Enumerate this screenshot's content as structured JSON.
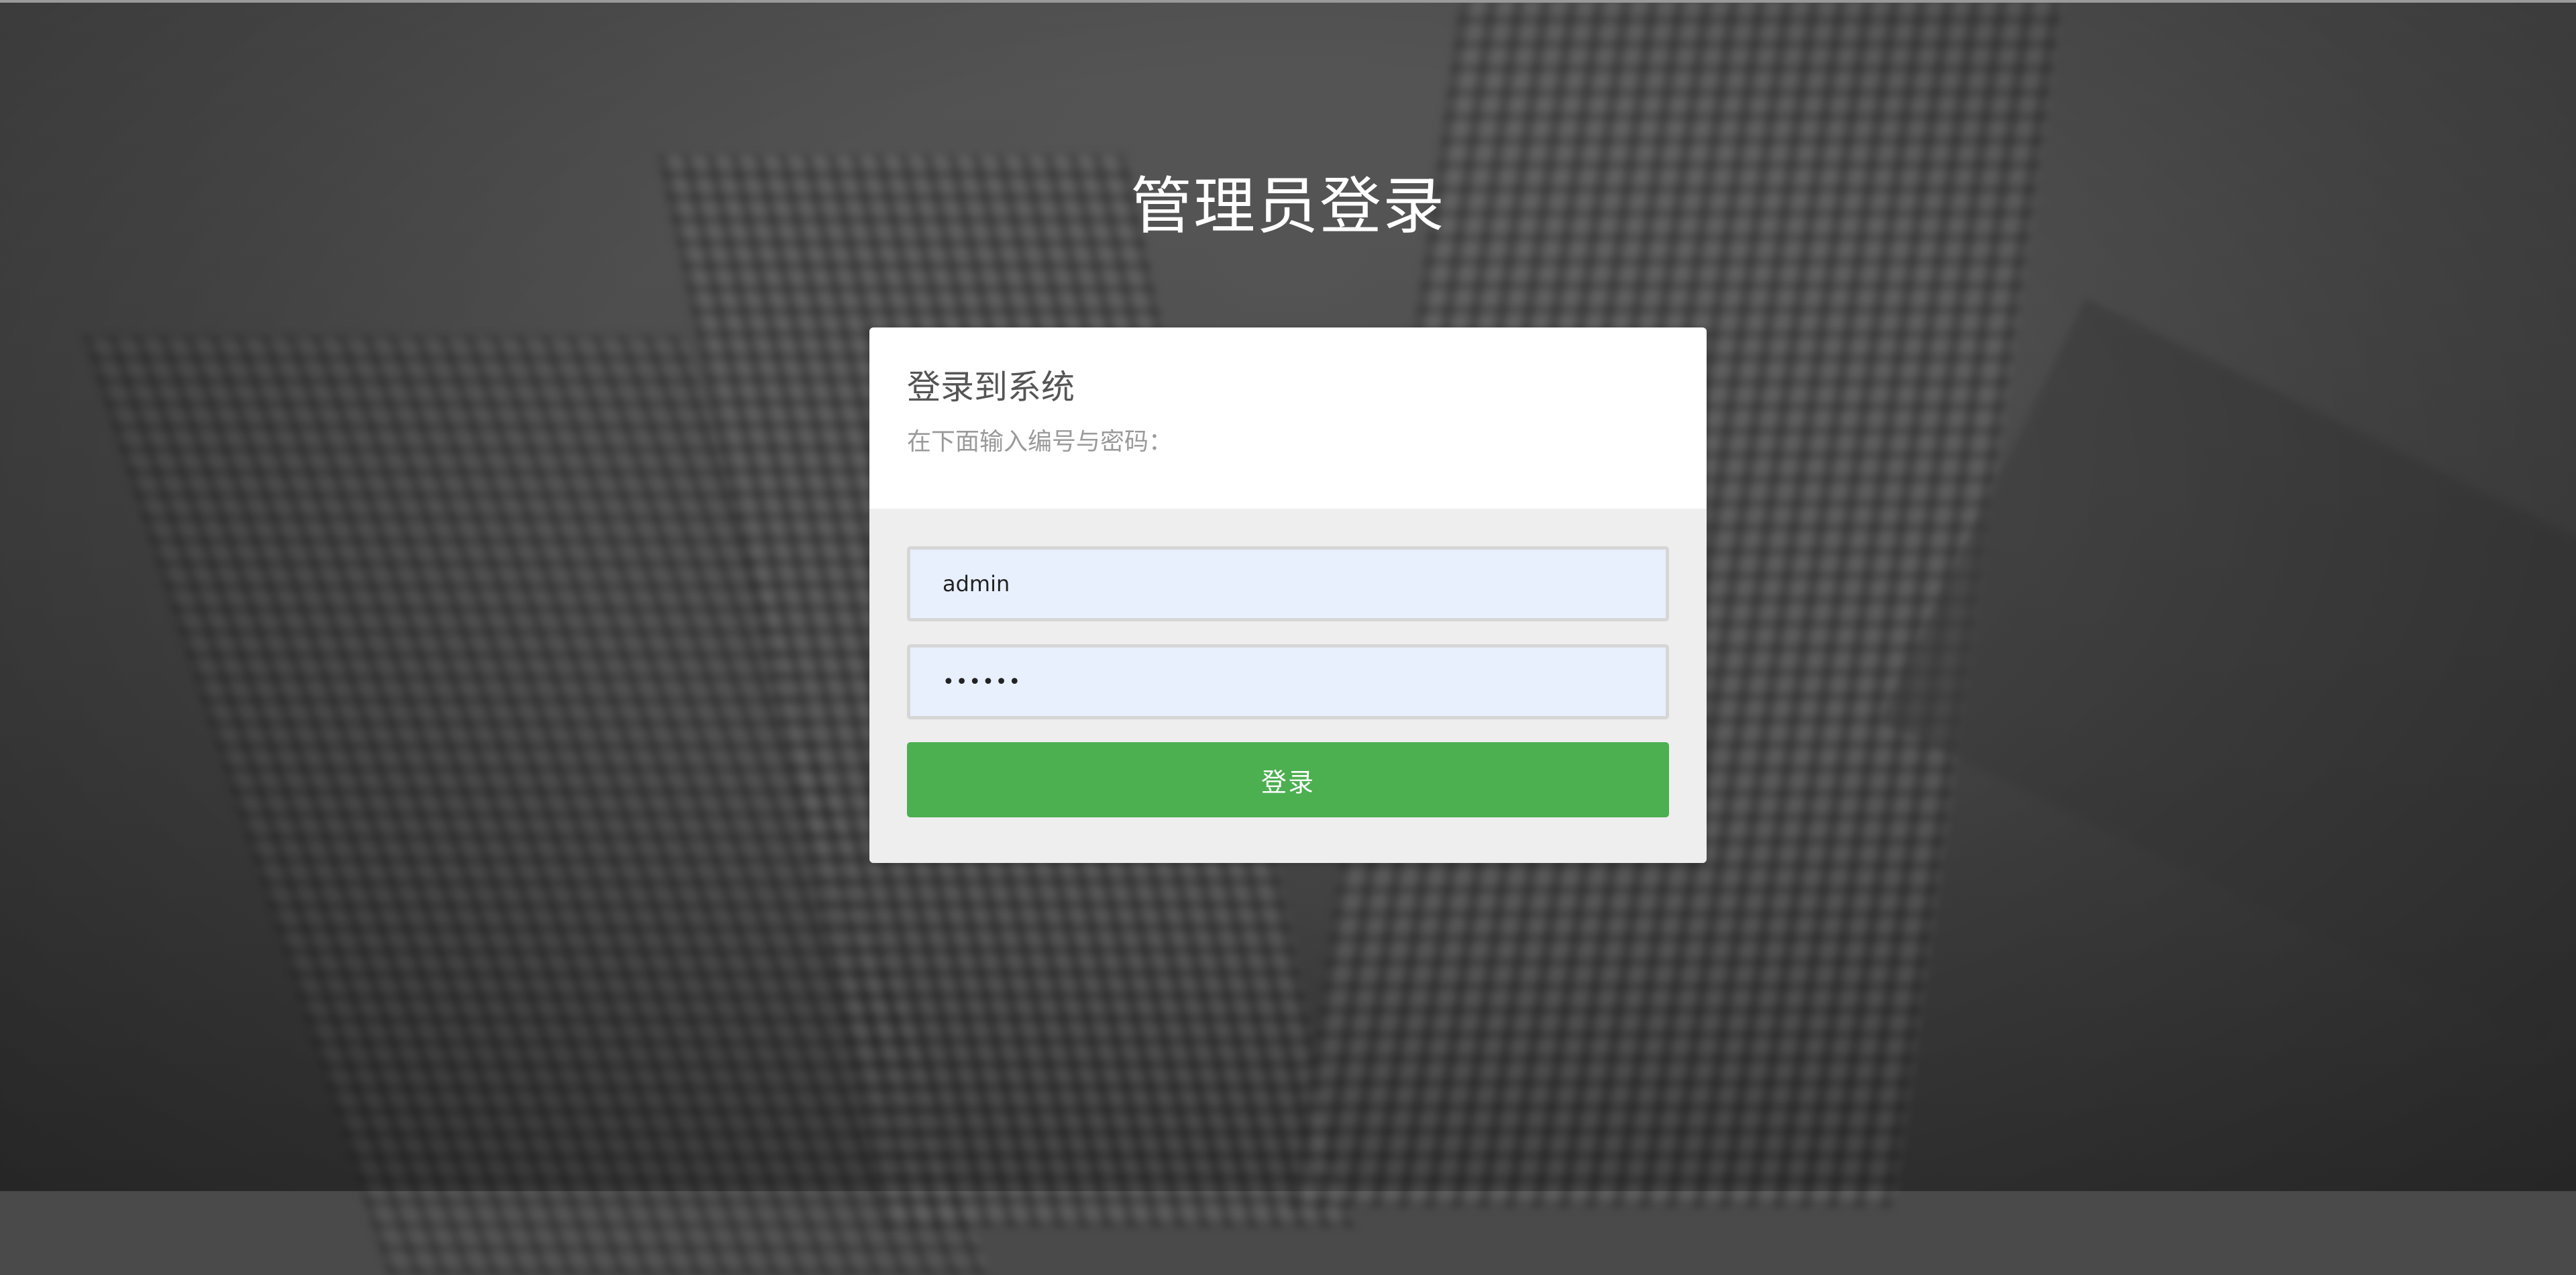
{
  "page": {
    "title": "管理员登录"
  },
  "card": {
    "heading": "登录到系统",
    "subtitle": "在下面输入编号与密码："
  },
  "form": {
    "username_value": "admin",
    "password_value": "123456",
    "login_button": "登录"
  },
  "colors": {
    "button": "#4caf50",
    "input_bg": "#e8f0fe",
    "form_bg": "#eeeeee"
  }
}
